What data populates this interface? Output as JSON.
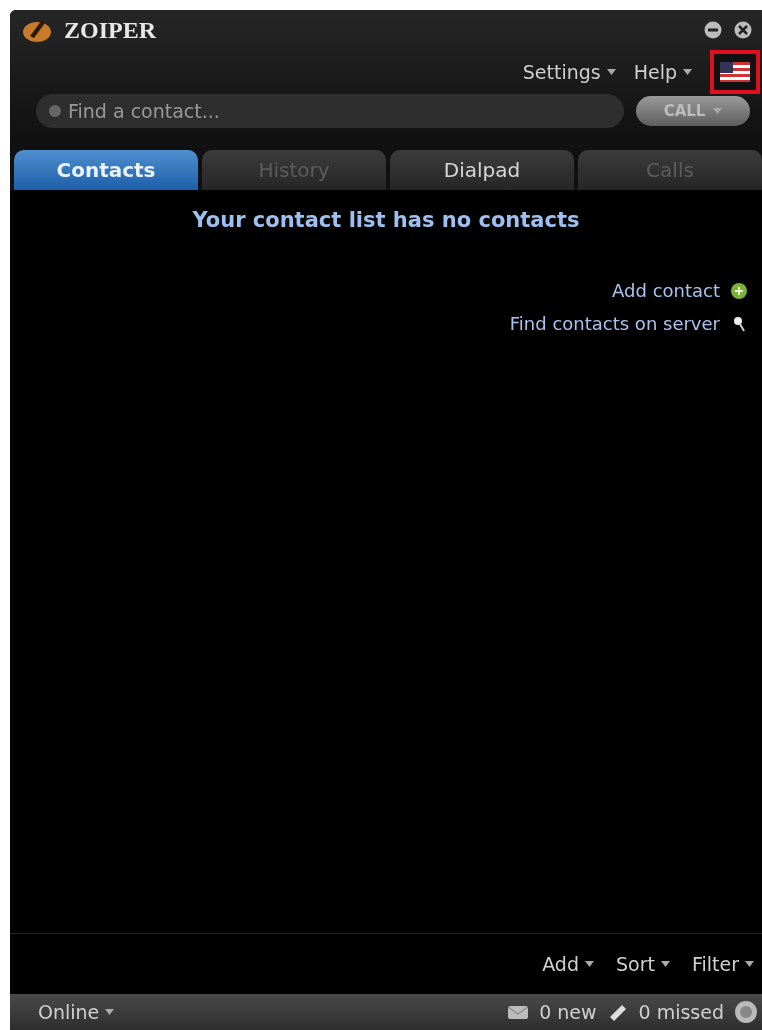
{
  "window": {
    "title": "ZOIPER"
  },
  "menu": [
    {
      "label": "Settings"
    },
    {
      "label": "Help"
    }
  ],
  "language_button": {
    "highlighted": true
  },
  "search": {
    "placeholder": "Find a contact..."
  },
  "call_button": {
    "label": "CALL",
    "disabled": true
  },
  "tabs": [
    {
      "label": "Contacts",
      "selected": true,
      "disabled": false
    },
    {
      "label": "History",
      "selected": false,
      "disabled": true
    },
    {
      "label": "Dialpad",
      "selected": false,
      "disabled": false
    },
    {
      "label": "Calls",
      "selected": false,
      "disabled": true
    }
  ],
  "contacts": {
    "empty_message": "Your contact list has no contacts",
    "actions": [
      {
        "label": "Add contact",
        "kind": "add"
      },
      {
        "label": "Find contacts on server",
        "kind": "find"
      }
    ]
  },
  "toolbar": [
    {
      "label": "Add"
    },
    {
      "label": "Sort"
    },
    {
      "label": "Filter"
    }
  ],
  "status_bar": {
    "presence": "Online",
    "messages": "0 new",
    "missed_calls": "0 missed"
  }
}
